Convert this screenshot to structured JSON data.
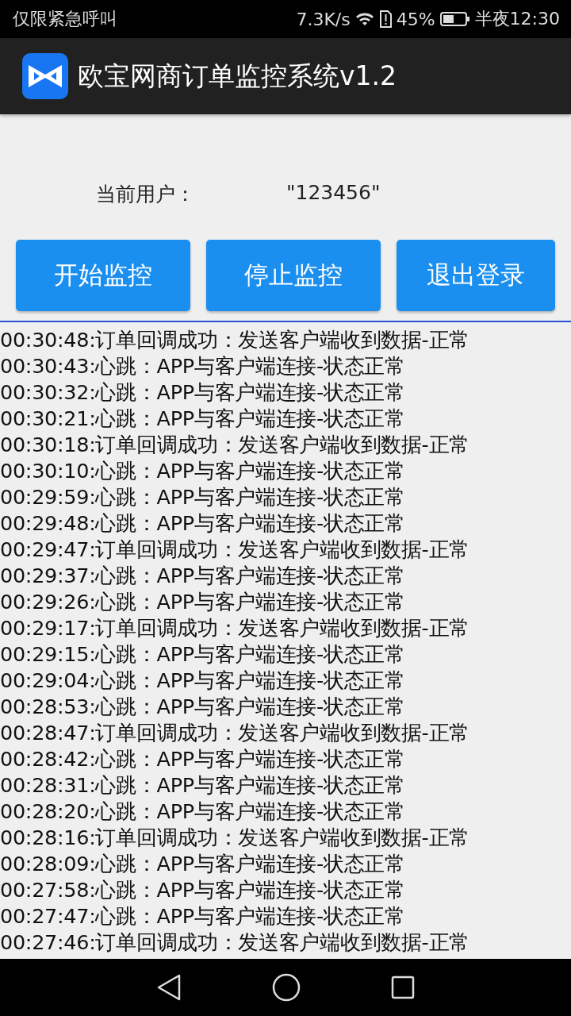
{
  "status_bar": {
    "carrier": "仅限紧急呼叫",
    "speed": "7.3K/s",
    "battery": "45%",
    "time": "半夜12:30"
  },
  "app_bar": {
    "title": "欧宝网商订单监控系统v1.2"
  },
  "user": {
    "label": "当前用户：",
    "value": "\"123456\""
  },
  "buttons": [
    "开始监控",
    "停止监控",
    "退出登录"
  ],
  "log": [
    "00:30:48:订单回调成功：发送客户端收到数据-正常",
    "00:30:43:心跳：APP与客户端连接-状态正常",
    "00:30:32:心跳：APP与客户端连接-状态正常",
    "00:30:21:心跳：APP与客户端连接-状态正常",
    "00:30:18:订单回调成功：发送客户端收到数据-正常",
    "00:30:10:心跳：APP与客户端连接-状态正常",
    "00:29:59:心跳：APP与客户端连接-状态正常",
    "00:29:48:心跳：APP与客户端连接-状态正常",
    "00:29:47:订单回调成功：发送客户端收到数据-正常",
    "00:29:37:心跳：APP与客户端连接-状态正常",
    "00:29:26:心跳：APP与客户端连接-状态正常",
    "00:29:17:订单回调成功：发送客户端收到数据-正常",
    "00:29:15:心跳：APP与客户端连接-状态正常",
    "00:29:04:心跳：APP与客户端连接-状态正常",
    "00:28:53:心跳：APP与客户端连接-状态正常",
    "00:28:47:订单回调成功：发送客户端收到数据-正常",
    "00:28:42:心跳：APP与客户端连接-状态正常",
    "00:28:31:心跳：APP与客户端连接-状态正常",
    "00:28:20:心跳：APP与客户端连接-状态正常",
    "00:28:16:订单回调成功：发送客户端收到数据-正常",
    "00:28:09:心跳：APP与客户端连接-状态正常",
    "00:27:58:心跳：APP与客户端连接-状态正常",
    "00:27:47:心跳：APP与客户端连接-状态正常",
    "00:27:46:订单回调成功：发送客户端收到数据-正常"
  ]
}
